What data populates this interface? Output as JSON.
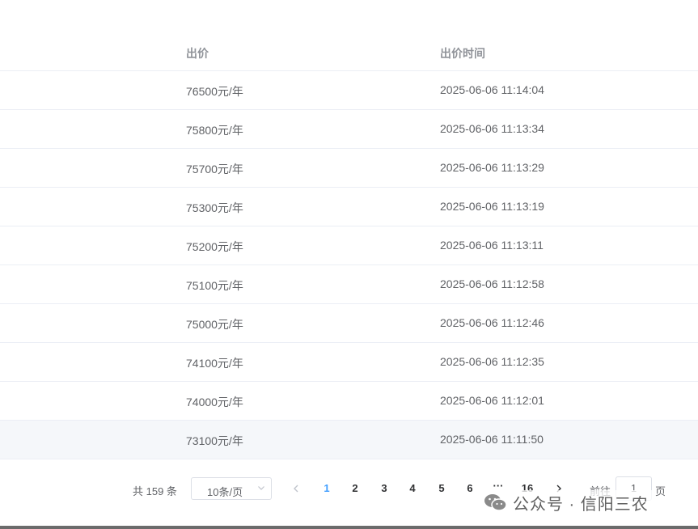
{
  "table": {
    "headers": {
      "price": "出价",
      "time": "出价时间"
    },
    "rows": [
      {
        "price": "76500元/年",
        "time": "2025-06-06 11:14:04"
      },
      {
        "price": "75800元/年",
        "time": "2025-06-06 11:13:34"
      },
      {
        "price": "75700元/年",
        "time": "2025-06-06 11:13:29"
      },
      {
        "price": "75300元/年",
        "time": "2025-06-06 11:13:19"
      },
      {
        "price": "75200元/年",
        "time": "2025-06-06 11:13:11"
      },
      {
        "price": "75100元/年",
        "time": "2025-06-06 11:12:58"
      },
      {
        "price": "75000元/年",
        "time": "2025-06-06 11:12:46"
      },
      {
        "price": "74100元/年",
        "time": "2025-06-06 11:12:35"
      },
      {
        "price": "74000元/年",
        "time": "2025-06-06 11:12:01"
      },
      {
        "price": "73100元/年",
        "time": "2025-06-06 11:11:50"
      }
    ]
  },
  "pagination": {
    "total": "共 159 条",
    "page_size": "10条/页",
    "pages": [
      "1",
      "2",
      "3",
      "4",
      "5",
      "6",
      "···",
      "16"
    ],
    "current": "1",
    "goto_label": "前往",
    "goto_value": "1",
    "page_unit": "页"
  },
  "watermark": {
    "text": "公众号 · 信阳三农",
    "icon": "wechat-icon"
  },
  "colors": {
    "accent": "#409eff",
    "header_text": "#909399",
    "row_border": "#ebeef5",
    "hover_row": "#f5f7fa"
  }
}
